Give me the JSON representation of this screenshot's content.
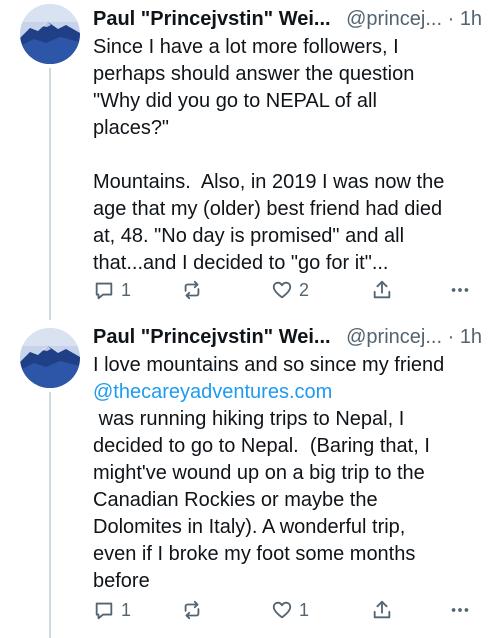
{
  "posts": [
    {
      "author_name": "Paul \"Princejvstin\" Wei...",
      "handle": "@princej...",
      "separator": "·",
      "time": "1h",
      "text": "Since I have a lot more followers, I\nperhaps should answer the question\n\"Why did you go to NEPAL of all\nplaces?\"\n\nMountains.  Also, in 2019 I was now the\nage that my (older) best friend had died\nat, 48. \"No day is promised\" and all\nthat...and I decided to \"go for it\"...",
      "replies": "1",
      "likes": "2"
    },
    {
      "author_name": "Paul \"Princejvstin\" Wei...",
      "handle": "@princej...",
      "separator": "·",
      "time": "1h",
      "text_before_link": "I love mountains and so since my friend",
      "link": "@thecareyadventures.com",
      "text_after_link": " was running hiking trips to Nepal, I\ndecided to go to Nepal.  (Baring that, I\nmight've wound up on a big trip to the\nCanadian Rockies or maybe the\nDolomites in Italy). A wonderful trip,\neven if I broke my foot some months\nbefore",
      "replies": "1",
      "likes": "1"
    }
  ],
  "icons": {
    "reply": "reply-icon",
    "repost": "repost-icon",
    "like": "heart-icon",
    "share": "share-icon",
    "more": "more-icon"
  },
  "colors": {
    "text": "#0f1419",
    "muted": "#536471",
    "link": "#1d9bf0",
    "avatar_sky": "#c6d3ea",
    "avatar_mountain": "#1f3f86"
  }
}
